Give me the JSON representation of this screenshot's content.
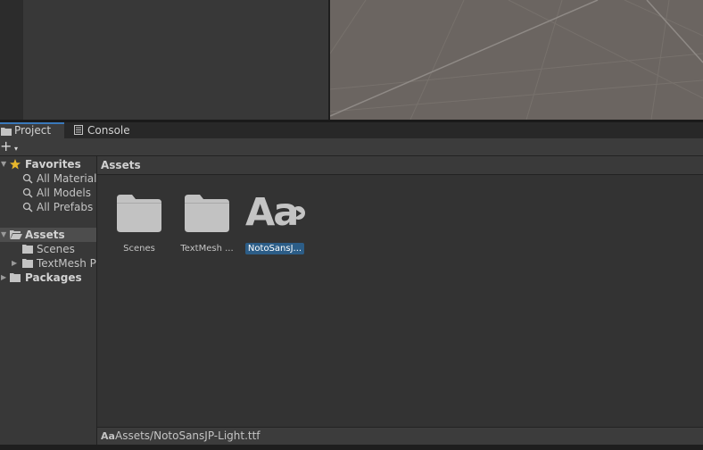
{
  "tabs": [
    {
      "label": "Project",
      "icon": "folder-icon",
      "active": true
    },
    {
      "label": "Console",
      "icon": "console-icon",
      "active": false
    }
  ],
  "toolbar": {
    "add_label": "+",
    "add_caret": "▾"
  },
  "tree": {
    "favorites": {
      "label": "Favorites",
      "items": [
        "All Materials",
        "All Models",
        "All Prefabs"
      ]
    },
    "assets": {
      "label": "Assets",
      "children": [
        "Scenes",
        "TextMesh P"
      ]
    },
    "packages": {
      "label": "Packages"
    }
  },
  "grid": {
    "header": "Assets",
    "items": [
      {
        "label": "Scenes",
        "icon": "folder-icon"
      },
      {
        "label": "TextMesh ...",
        "icon": "folder-icon"
      },
      {
        "label": "NotoSansJ...",
        "icon": "font-icon",
        "glyph": "Aa",
        "selected": true
      }
    ]
  },
  "status": {
    "icon_text": "Aa",
    "path": "Assets/NotoSansJP-Light.ttf"
  },
  "colors": {
    "accent": "#3a79bb",
    "selection": "#2c5d87",
    "favorite_star": "#e8b72c"
  }
}
